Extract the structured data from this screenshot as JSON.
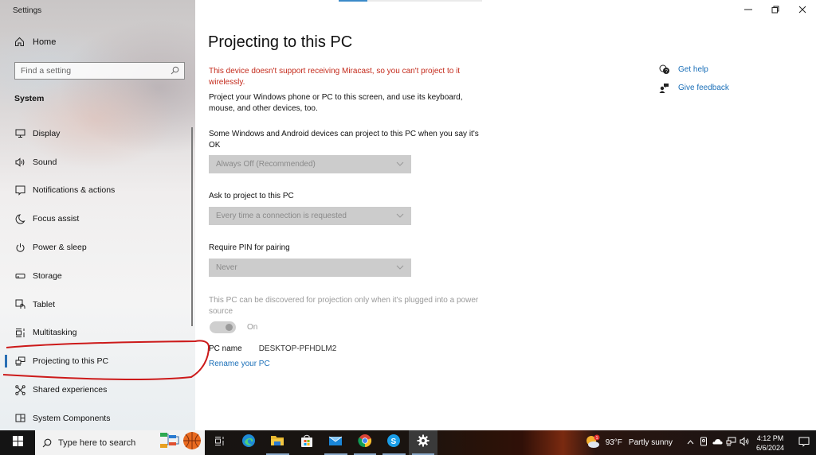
{
  "window": {
    "app_title": "Settings",
    "minimize_icon": "minimize-icon",
    "maximize_icon": "restore-icon",
    "close_icon": "close-icon",
    "top_progress_fraction": 0.2
  },
  "sidebar": {
    "home_label": "Home",
    "search_placeholder": "Find a setting",
    "section_label": "System",
    "items": [
      {
        "label": "Display",
        "icon": "display-icon"
      },
      {
        "label": "Sound",
        "icon": "sound-icon"
      },
      {
        "label": "Notifications & actions",
        "icon": "notifications-icon"
      },
      {
        "label": "Focus assist",
        "icon": "moon-icon"
      },
      {
        "label": "Power & sleep",
        "icon": "power-icon"
      },
      {
        "label": "Storage",
        "icon": "storage-icon"
      },
      {
        "label": "Tablet",
        "icon": "tablet-icon"
      },
      {
        "label": "Multitasking",
        "icon": "multitasking-icon"
      },
      {
        "label": "Projecting to this PC",
        "icon": "projecting-icon",
        "active": true
      },
      {
        "label": "Shared experiences",
        "icon": "shared-experiences-icon"
      },
      {
        "label": "System Components",
        "icon": "system-components-icon"
      }
    ]
  },
  "main": {
    "title": "Projecting to this PC",
    "warning": "This device doesn't support receiving Miracast, so you can't project to it wirelessly.",
    "intro": "Project your Windows phone or PC to this screen, and use its keyboard, mouse, and other devices, too.",
    "setting1_label": "Some Windows and Android devices can project to this PC when you say it's OK",
    "setting1_value": "Always Off (Recommended)",
    "setting2_label": "Ask to project to this PC",
    "setting2_value": "Every time a connection is requested",
    "setting3_label": "Require PIN for pairing",
    "setting3_value": "Never",
    "power_note": "This PC can be discovered for projection only when it's plugged into a power source",
    "power_toggle_label": "On",
    "power_toggle_on": true,
    "pc_name_label": "PC name",
    "pc_name_value": "DESKTOP-PFHDLM2",
    "rename_link": "Rename your PC"
  },
  "help": {
    "get_help": "Get help",
    "give_feedback": "Give feedback"
  },
  "taskbar": {
    "search_placeholder": "Type here to search",
    "apps": [
      {
        "name": "task-view-icon"
      },
      {
        "name": "edge-icon",
        "running": false
      },
      {
        "name": "file-explorer-icon",
        "running": true
      },
      {
        "name": "microsoft-store-icon",
        "running": false
      },
      {
        "name": "mail-icon",
        "running": true
      },
      {
        "name": "chrome-icon",
        "running": true
      },
      {
        "name": "skype-icon",
        "running": true
      },
      {
        "name": "settings-icon",
        "running": true,
        "active": true
      }
    ],
    "weather_temp": "93°F",
    "weather_desc": "Partly sunny",
    "weather_badge": "1",
    "time": "4:12 PM",
    "date": "6/6/2024"
  },
  "colors": {
    "accent": "#2a6fb4",
    "link": "#1a6fb8",
    "warning": "#c42b1c",
    "annotation": "#cc1a1a"
  }
}
